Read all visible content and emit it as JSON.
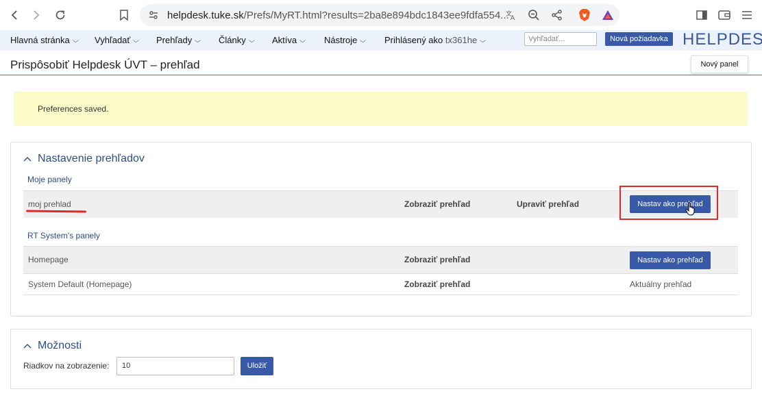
{
  "browser": {
    "url_host": "helpdesk.tuke.sk",
    "url_path": "/Prefs/MyRT.html?results=2ba8e894bdc1843ee9fdfa554..."
  },
  "topnav": {
    "items": [
      {
        "label": "Hlavná stránka"
      },
      {
        "label": "Vyhľadať"
      },
      {
        "label": "Prehľady"
      },
      {
        "label": "Články"
      },
      {
        "label": "Aktíva"
      },
      {
        "label": "Nástroje"
      },
      {
        "label": "Prihlásený ako",
        "user": "tx361he"
      }
    ],
    "search_placeholder": "Vyhľadať...",
    "new_ticket_label": "Nová požiadavka",
    "logo_text": "HELPDESK"
  },
  "page": {
    "title": "Prispôsobiť Helpdesk ÚVT – prehľad",
    "new_panel_label": "Nový panel"
  },
  "alert": {
    "message": "Preferences saved."
  },
  "dashboards": {
    "title": "Nastavenie prehľadov",
    "my_panels_heading": "Moje panely",
    "my_panels": [
      {
        "name": "moj prehlad",
        "show": "Zobraziť prehľad",
        "edit": "Upraviť prehľad",
        "action": "Nastav ako prehľad"
      }
    ],
    "system_panels_heading": "RT System's panely",
    "system_panels": [
      {
        "name": "Homepage",
        "show": "Zobraziť prehľad",
        "action": "Nastav ako prehľad"
      },
      {
        "name": "System Default (Homepage)",
        "show": "Zobraziť prehľad",
        "status": "Aktuálny prehľad"
      }
    ]
  },
  "options": {
    "title": "Možnosti",
    "rows_label": "Riadkov na zobrazenie:",
    "rows_value": "10",
    "save_label": "Uložiť"
  },
  "colors": {
    "accent": "#3858a8",
    "link": "#2c4e86",
    "alert_bg": "#fcfac8",
    "highlight": "#e3262a"
  }
}
